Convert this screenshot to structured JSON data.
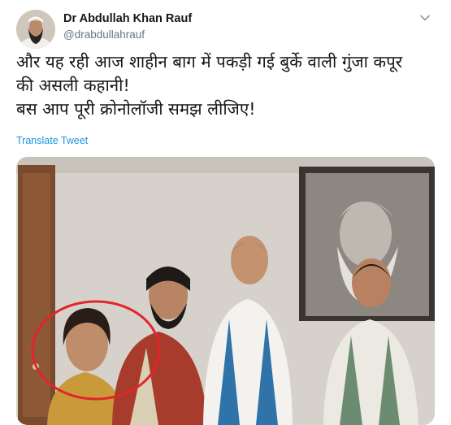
{
  "author": {
    "display_name": "Dr Abdullah Khan Rauf",
    "handle": "@drabdullahrauf",
    "avatar_icon": "profile-avatar"
  },
  "tweet": {
    "lines": [
      "और यह रही आज शाहीन बाग में पकड़ी गई बुर्के वाली गुंजा कपूर",
      "की असली कहानी!",
      "बस आप पूरी क्रोनोलॉजी समझ लीजिए!"
    ],
    "translate_label": "Translate Tweet"
  },
  "media": {
    "description_icon": "photo",
    "highlight_color": "#e3242b"
  },
  "colors": {
    "link": "#1b95e0",
    "secondary_text": "#657786",
    "primary_text": "#14171a"
  }
}
